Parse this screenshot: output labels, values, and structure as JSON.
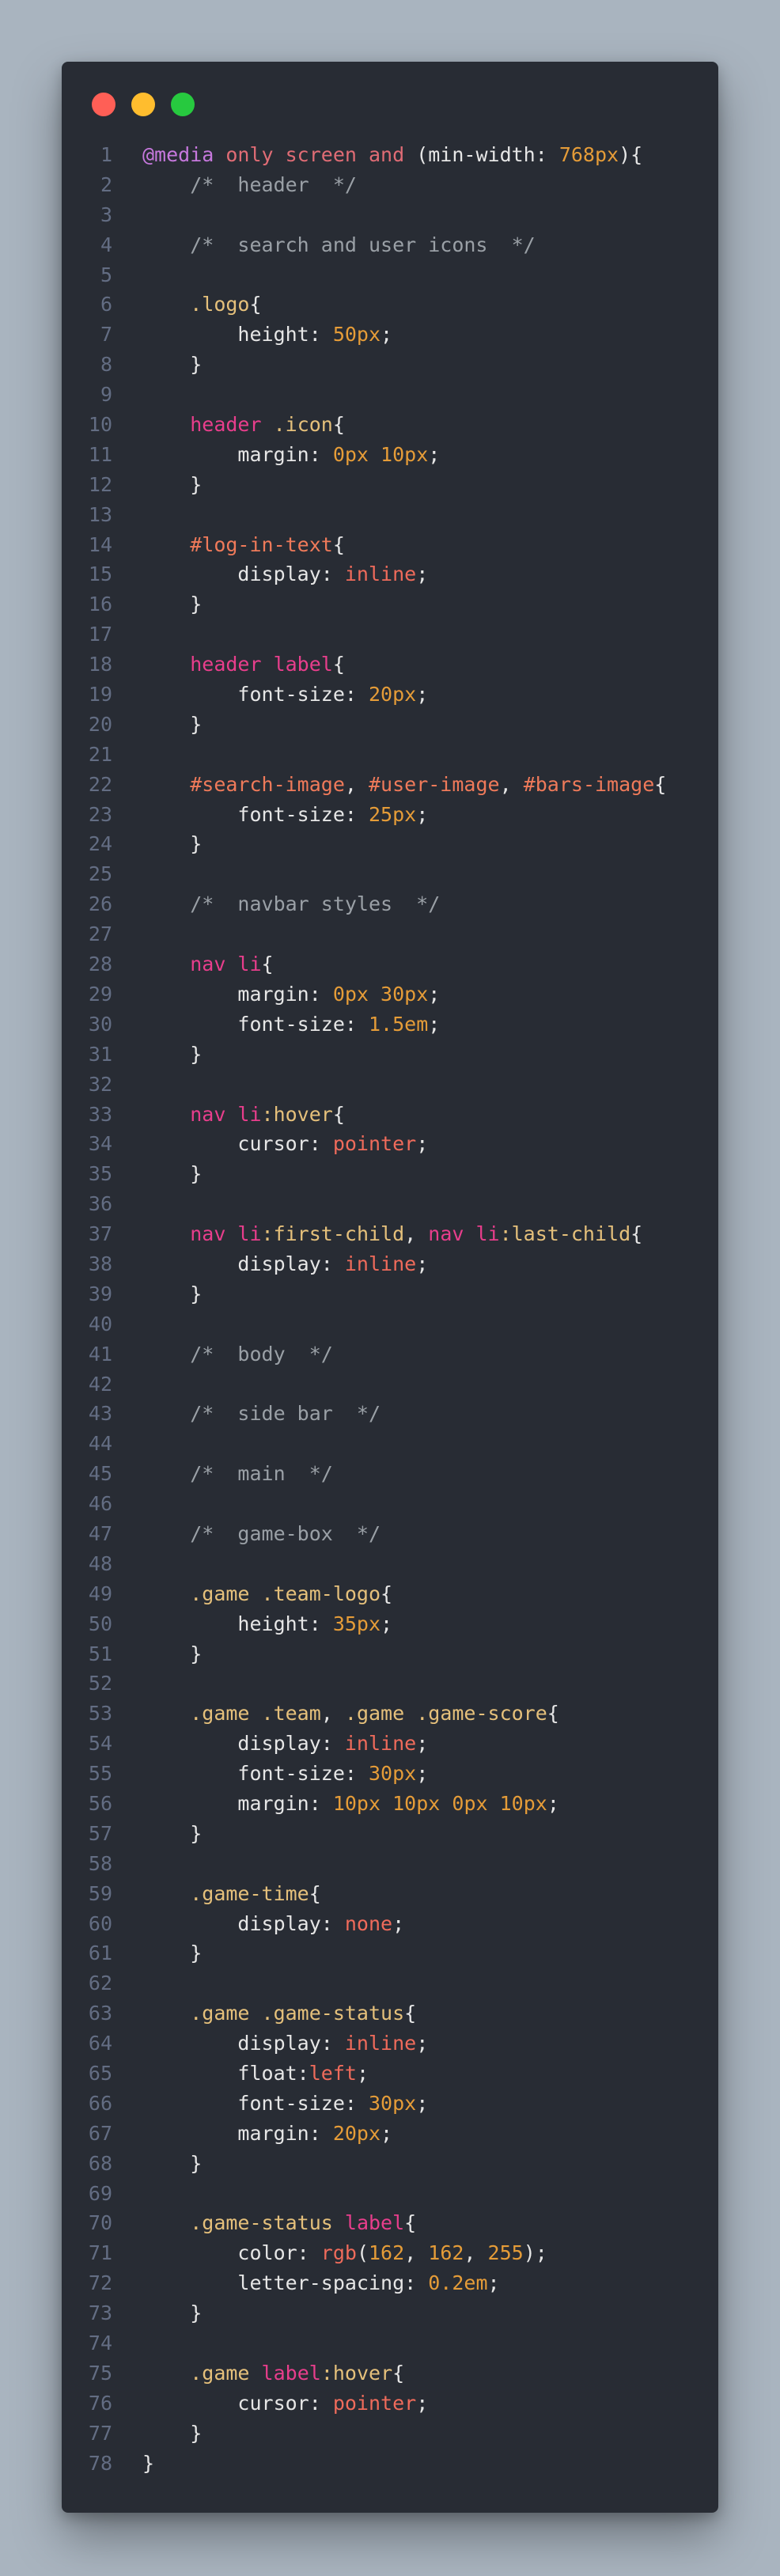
{
  "window": {
    "title_buttons": [
      {
        "name": "close",
        "color": "#ff5f56"
      },
      {
        "name": "minimize",
        "color": "#ffbd2e"
      },
      {
        "name": "maximize",
        "color": "#27c93f"
      }
    ]
  },
  "colors": {
    "plain": "#e6e6e6",
    "comment": "#9aa0a6",
    "at": "#c678dd",
    "keyword": "#e06c75",
    "selector": "#e5c07b",
    "tag": "#e83e8c",
    "id": "#ef7a5a",
    "number": "#e59c38",
    "value": "#ef6b5b",
    "linenum": "#636d83"
  },
  "lines": [
    {
      "n": "1",
      "tokens": [
        [
          "at",
          "@media"
        ],
        [
          "plain",
          " "
        ],
        [
          "keyword",
          "only screen and"
        ],
        [
          "plain",
          " (min-width: "
        ],
        [
          "number",
          "768px"
        ],
        [
          "plain",
          "){"
        ]
      ]
    },
    {
      "n": "2",
      "tokens": [
        [
          "comment",
          "    /*  header  */"
        ]
      ]
    },
    {
      "n": "3",
      "tokens": []
    },
    {
      "n": "4",
      "tokens": [
        [
          "comment",
          "    /*  search and user icons  */"
        ]
      ]
    },
    {
      "n": "5",
      "tokens": []
    },
    {
      "n": "6",
      "tokens": [
        [
          "plain",
          "    "
        ],
        [
          "selector",
          ".logo"
        ],
        [
          "plain",
          "{"
        ]
      ]
    },
    {
      "n": "7",
      "tokens": [
        [
          "plain",
          "        height: "
        ],
        [
          "number",
          "50px"
        ],
        [
          "plain",
          ";"
        ]
      ]
    },
    {
      "n": "8",
      "tokens": [
        [
          "plain",
          "    }"
        ]
      ]
    },
    {
      "n": "9",
      "tokens": []
    },
    {
      "n": "10",
      "tokens": [
        [
          "plain",
          "    "
        ],
        [
          "tag",
          "header"
        ],
        [
          "plain",
          " "
        ],
        [
          "selector",
          ".icon"
        ],
        [
          "plain",
          "{"
        ]
      ]
    },
    {
      "n": "11",
      "tokens": [
        [
          "plain",
          "        margin: "
        ],
        [
          "number",
          "0px"
        ],
        [
          "plain",
          " "
        ],
        [
          "number",
          "10px"
        ],
        [
          "plain",
          ";"
        ]
      ]
    },
    {
      "n": "12",
      "tokens": [
        [
          "plain",
          "    }"
        ]
      ]
    },
    {
      "n": "13",
      "tokens": []
    },
    {
      "n": "14",
      "tokens": [
        [
          "plain",
          "    "
        ],
        [
          "id",
          "#log-in-text"
        ],
        [
          "plain",
          "{"
        ]
      ]
    },
    {
      "n": "15",
      "tokens": [
        [
          "plain",
          "        display: "
        ],
        [
          "value",
          "inline"
        ],
        [
          "plain",
          ";"
        ]
      ]
    },
    {
      "n": "16",
      "tokens": [
        [
          "plain",
          "    }"
        ]
      ]
    },
    {
      "n": "17",
      "tokens": []
    },
    {
      "n": "18",
      "tokens": [
        [
          "plain",
          "    "
        ],
        [
          "tag",
          "header label"
        ],
        [
          "plain",
          "{"
        ]
      ]
    },
    {
      "n": "19",
      "tokens": [
        [
          "plain",
          "        font-size: "
        ],
        [
          "number",
          "20px"
        ],
        [
          "plain",
          ";"
        ]
      ]
    },
    {
      "n": "20",
      "tokens": [
        [
          "plain",
          "    }"
        ]
      ]
    },
    {
      "n": "21",
      "tokens": []
    },
    {
      "n": "22",
      "tokens": [
        [
          "plain",
          "    "
        ],
        [
          "id",
          "#search-image"
        ],
        [
          "plain",
          ", "
        ],
        [
          "id",
          "#user-image"
        ],
        [
          "plain",
          ", "
        ],
        [
          "id",
          "#bars-image"
        ],
        [
          "plain",
          "{"
        ]
      ]
    },
    {
      "n": "23",
      "tokens": [
        [
          "plain",
          "        font-size: "
        ],
        [
          "number",
          "25px"
        ],
        [
          "plain",
          ";"
        ]
      ]
    },
    {
      "n": "24",
      "tokens": [
        [
          "plain",
          "    }"
        ]
      ]
    },
    {
      "n": "25",
      "tokens": []
    },
    {
      "n": "26",
      "tokens": [
        [
          "comment",
          "    /*  navbar styles  */"
        ]
      ]
    },
    {
      "n": "27",
      "tokens": []
    },
    {
      "n": "28",
      "tokens": [
        [
          "plain",
          "    "
        ],
        [
          "tag",
          "nav li"
        ],
        [
          "plain",
          "{"
        ]
      ]
    },
    {
      "n": "29",
      "tokens": [
        [
          "plain",
          "        margin: "
        ],
        [
          "number",
          "0px"
        ],
        [
          "plain",
          " "
        ],
        [
          "number",
          "30px"
        ],
        [
          "plain",
          ";"
        ]
      ]
    },
    {
      "n": "30",
      "tokens": [
        [
          "plain",
          "        font-size: "
        ],
        [
          "number",
          "1.5em"
        ],
        [
          "plain",
          ";"
        ]
      ]
    },
    {
      "n": "31",
      "tokens": [
        [
          "plain",
          "    }"
        ]
      ]
    },
    {
      "n": "32",
      "tokens": []
    },
    {
      "n": "33",
      "tokens": [
        [
          "plain",
          "    "
        ],
        [
          "tag",
          "nav li"
        ],
        [
          "selector",
          ":hover"
        ],
        [
          "plain",
          "{"
        ]
      ]
    },
    {
      "n": "34",
      "tokens": [
        [
          "plain",
          "        cursor: "
        ],
        [
          "value",
          "pointer"
        ],
        [
          "plain",
          ";"
        ]
      ]
    },
    {
      "n": "35",
      "tokens": [
        [
          "plain",
          "    }"
        ]
      ]
    },
    {
      "n": "36",
      "tokens": []
    },
    {
      "n": "37",
      "tokens": [
        [
          "plain",
          "    "
        ],
        [
          "tag",
          "nav li"
        ],
        [
          "selector",
          ":first-child"
        ],
        [
          "plain",
          ", "
        ],
        [
          "tag",
          "nav li"
        ],
        [
          "selector",
          ":last-child"
        ],
        [
          "plain",
          "{"
        ]
      ]
    },
    {
      "n": "38",
      "tokens": [
        [
          "plain",
          "        display: "
        ],
        [
          "value",
          "inline"
        ],
        [
          "plain",
          ";"
        ]
      ]
    },
    {
      "n": "39",
      "tokens": [
        [
          "plain",
          "    }"
        ]
      ]
    },
    {
      "n": "40",
      "tokens": []
    },
    {
      "n": "41",
      "tokens": [
        [
          "comment",
          "    /*  body  */"
        ]
      ]
    },
    {
      "n": "42",
      "tokens": []
    },
    {
      "n": "43",
      "tokens": [
        [
          "comment",
          "    /*  side bar  */"
        ]
      ]
    },
    {
      "n": "44",
      "tokens": []
    },
    {
      "n": "45",
      "tokens": [
        [
          "comment",
          "    /*  main  */"
        ]
      ]
    },
    {
      "n": "46",
      "tokens": []
    },
    {
      "n": "47",
      "tokens": [
        [
          "comment",
          "    /*  game-box  */"
        ]
      ]
    },
    {
      "n": "48",
      "tokens": []
    },
    {
      "n": "49",
      "tokens": [
        [
          "plain",
          "    "
        ],
        [
          "selector",
          ".game .team-logo"
        ],
        [
          "plain",
          "{"
        ]
      ]
    },
    {
      "n": "50",
      "tokens": [
        [
          "plain",
          "        height: "
        ],
        [
          "number",
          "35px"
        ],
        [
          "plain",
          ";"
        ]
      ]
    },
    {
      "n": "51",
      "tokens": [
        [
          "plain",
          "    }"
        ]
      ]
    },
    {
      "n": "52",
      "tokens": []
    },
    {
      "n": "53",
      "tokens": [
        [
          "plain",
          "    "
        ],
        [
          "selector",
          ".game .team"
        ],
        [
          "plain",
          ", "
        ],
        [
          "selector",
          ".game .game-score"
        ],
        [
          "plain",
          "{"
        ]
      ]
    },
    {
      "n": "54",
      "tokens": [
        [
          "plain",
          "        display: "
        ],
        [
          "value",
          "inline"
        ],
        [
          "plain",
          ";"
        ]
      ]
    },
    {
      "n": "55",
      "tokens": [
        [
          "plain",
          "        font-size: "
        ],
        [
          "number",
          "30px"
        ],
        [
          "plain",
          ";"
        ]
      ]
    },
    {
      "n": "56",
      "tokens": [
        [
          "plain",
          "        margin: "
        ],
        [
          "number",
          "10px"
        ],
        [
          "plain",
          " "
        ],
        [
          "number",
          "10px"
        ],
        [
          "plain",
          " "
        ],
        [
          "number",
          "0px"
        ],
        [
          "plain",
          " "
        ],
        [
          "number",
          "10px"
        ],
        [
          "plain",
          ";"
        ]
      ]
    },
    {
      "n": "57",
      "tokens": [
        [
          "plain",
          "    }"
        ]
      ]
    },
    {
      "n": "58",
      "tokens": []
    },
    {
      "n": "59",
      "tokens": [
        [
          "plain",
          "    "
        ],
        [
          "selector",
          ".game-time"
        ],
        [
          "plain",
          "{"
        ]
      ]
    },
    {
      "n": "60",
      "tokens": [
        [
          "plain",
          "        display: "
        ],
        [
          "value",
          "none"
        ],
        [
          "plain",
          ";"
        ]
      ]
    },
    {
      "n": "61",
      "tokens": [
        [
          "plain",
          "    }"
        ]
      ]
    },
    {
      "n": "62",
      "tokens": []
    },
    {
      "n": "63",
      "tokens": [
        [
          "plain",
          "    "
        ],
        [
          "selector",
          ".game .game-status"
        ],
        [
          "plain",
          "{"
        ]
      ]
    },
    {
      "n": "64",
      "tokens": [
        [
          "plain",
          "        display: "
        ],
        [
          "value",
          "inline"
        ],
        [
          "plain",
          ";"
        ]
      ]
    },
    {
      "n": "65",
      "tokens": [
        [
          "plain",
          "        float:"
        ],
        [
          "value",
          "left"
        ],
        [
          "plain",
          ";"
        ]
      ]
    },
    {
      "n": "66",
      "tokens": [
        [
          "plain",
          "        font-size: "
        ],
        [
          "number",
          "30px"
        ],
        [
          "plain",
          ";"
        ]
      ]
    },
    {
      "n": "67",
      "tokens": [
        [
          "plain",
          "        margin: "
        ],
        [
          "number",
          "20px"
        ],
        [
          "plain",
          ";"
        ]
      ]
    },
    {
      "n": "68",
      "tokens": [
        [
          "plain",
          "    }"
        ]
      ]
    },
    {
      "n": "69",
      "tokens": []
    },
    {
      "n": "70",
      "tokens": [
        [
          "plain",
          "    "
        ],
        [
          "selector",
          ".game-status"
        ],
        [
          "plain",
          " "
        ],
        [
          "tag",
          "label"
        ],
        [
          "plain",
          "{"
        ]
      ]
    },
    {
      "n": "71",
      "tokens": [
        [
          "plain",
          "        color: "
        ],
        [
          "value",
          "rgb"
        ],
        [
          "plain",
          "("
        ],
        [
          "number",
          "162"
        ],
        [
          "plain",
          ", "
        ],
        [
          "number",
          "162"
        ],
        [
          "plain",
          ", "
        ],
        [
          "number",
          "255"
        ],
        [
          "plain",
          ");"
        ]
      ]
    },
    {
      "n": "72",
      "tokens": [
        [
          "plain",
          "        letter-spacing: "
        ],
        [
          "number",
          "0.2em"
        ],
        [
          "plain",
          ";"
        ]
      ]
    },
    {
      "n": "73",
      "tokens": [
        [
          "plain",
          "    }"
        ]
      ]
    },
    {
      "n": "74",
      "tokens": []
    },
    {
      "n": "75",
      "tokens": [
        [
          "plain",
          "    "
        ],
        [
          "selector",
          ".game"
        ],
        [
          "plain",
          " "
        ],
        [
          "tag",
          "label"
        ],
        [
          "selector",
          ":hover"
        ],
        [
          "plain",
          "{"
        ]
      ]
    },
    {
      "n": "76",
      "tokens": [
        [
          "plain",
          "        cursor: "
        ],
        [
          "value",
          "pointer"
        ],
        [
          "plain",
          ";"
        ]
      ]
    },
    {
      "n": "77",
      "tokens": [
        [
          "plain",
          "    }"
        ]
      ]
    },
    {
      "n": "78",
      "tokens": [
        [
          "plain",
          "}"
        ]
      ]
    }
  ]
}
